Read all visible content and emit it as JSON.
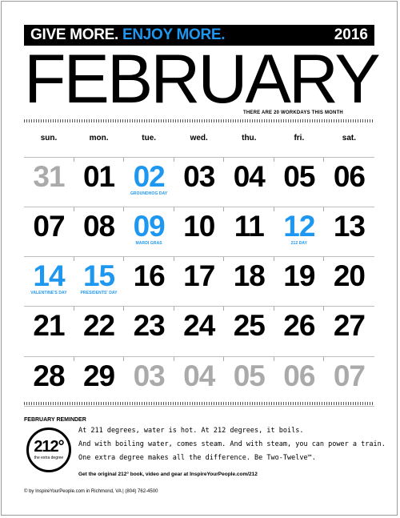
{
  "header": {
    "slogan_give": "GIVE MORE.",
    "slogan_enjoy": "ENJOY MORE.",
    "year": "2016",
    "month": "FEBRUARY",
    "workdays_note": "THERE ARE 20 WORKDAYS THIS MONTH"
  },
  "weekdays": [
    "sun.",
    "mon.",
    "tue.",
    "wed.",
    "thu.",
    "fri.",
    "sat."
  ],
  "weeks": [
    [
      {
        "d": "31",
        "k": "prev"
      },
      {
        "d": "01",
        "k": "cur"
      },
      {
        "d": "02",
        "k": "blue",
        "h": "GROUNDHOG DAY"
      },
      {
        "d": "03",
        "k": "cur"
      },
      {
        "d": "04",
        "k": "cur"
      },
      {
        "d": "05",
        "k": "cur"
      },
      {
        "d": "06",
        "k": "cur"
      }
    ],
    [
      {
        "d": "07",
        "k": "cur"
      },
      {
        "d": "08",
        "k": "cur"
      },
      {
        "d": "09",
        "k": "blue",
        "h": "MARDI GRAS"
      },
      {
        "d": "10",
        "k": "cur"
      },
      {
        "d": "11",
        "k": "cur"
      },
      {
        "d": "12",
        "k": "blue",
        "h": "212 DAY"
      },
      {
        "d": "13",
        "k": "cur"
      }
    ],
    [
      {
        "d": "14",
        "k": "blue",
        "h": "VALENTINE'S DAY"
      },
      {
        "d": "15",
        "k": "blue",
        "h": "PRESIDENTS' DAY"
      },
      {
        "d": "16",
        "k": "cur"
      },
      {
        "d": "17",
        "k": "cur"
      },
      {
        "d": "18",
        "k": "cur"
      },
      {
        "d": "19",
        "k": "cur"
      },
      {
        "d": "20",
        "k": "cur"
      }
    ],
    [
      {
        "d": "21",
        "k": "cur"
      },
      {
        "d": "22",
        "k": "cur"
      },
      {
        "d": "23",
        "k": "cur"
      },
      {
        "d": "24",
        "k": "cur"
      },
      {
        "d": "25",
        "k": "cur"
      },
      {
        "d": "26",
        "k": "cur"
      },
      {
        "d": "27",
        "k": "cur"
      }
    ],
    [
      {
        "d": "28",
        "k": "cur"
      },
      {
        "d": "29",
        "k": "cur"
      },
      {
        "d": "03",
        "k": "next"
      },
      {
        "d": "04",
        "k": "next"
      },
      {
        "d": "05",
        "k": "next"
      },
      {
        "d": "06",
        "k": "next"
      },
      {
        "d": "07",
        "k": "next"
      }
    ]
  ],
  "reminder": {
    "title": "FEBRUARY REMINDER",
    "logo_number": "212°",
    "logo_tagline": "the extra degree",
    "line1": "At 211 degrees, water is hot. At 212 degrees, it boils.",
    "line2": "And with boiling water, comes steam. And with steam, you can power a train.",
    "line3": "One extra degree makes all the difference. Be Two-Twelve™.",
    "promo": "Get the original 212° book, video and gear at InspireYourPeople.com/212"
  },
  "footer": "© by InspireYourPeople.com in Richmond, VA  |  (804) 762-4500",
  "colors": {
    "accent": "#1e97f0",
    "muted": "#aaaaaa"
  }
}
